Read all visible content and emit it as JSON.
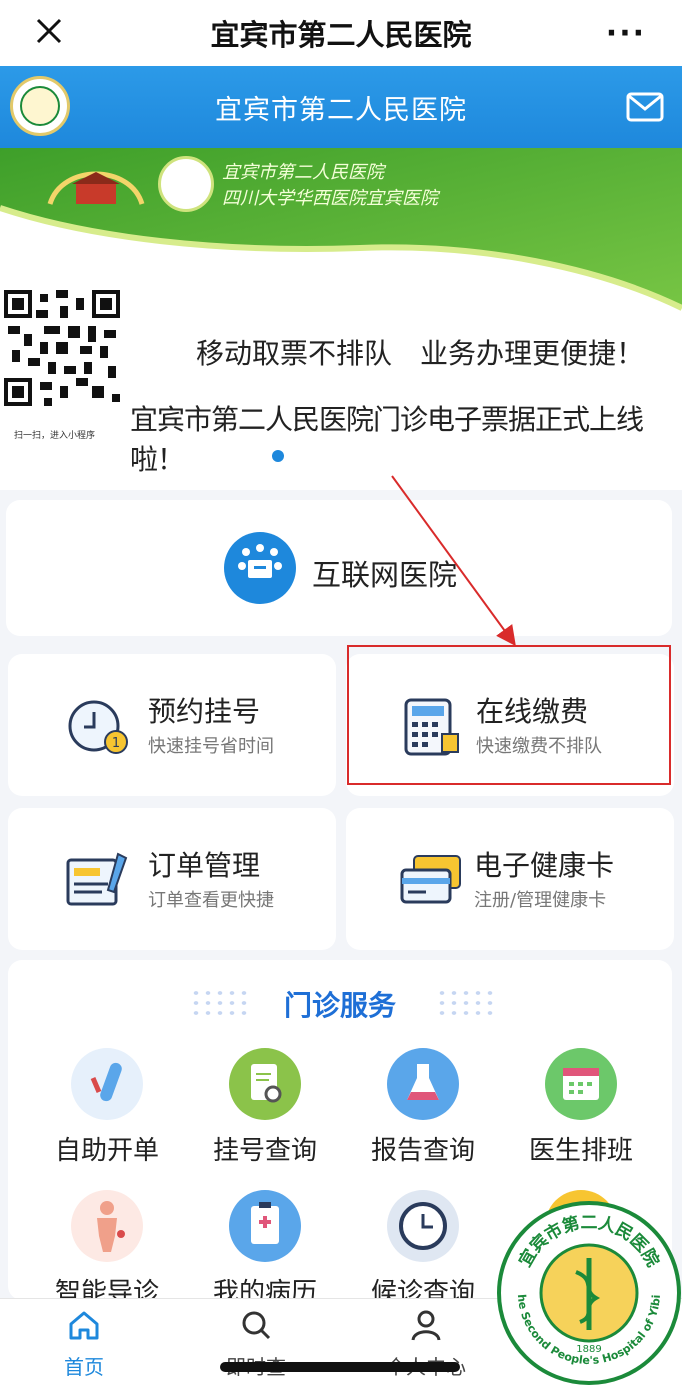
{
  "wechat_bar": {
    "title": "宜宾市第二人民医院",
    "more_label": "···"
  },
  "header": {
    "title": "宜宾市第二人民医院"
  },
  "banner": {
    "logo_text_line1": "宜宾市第二人民医院",
    "logo_text_line2": "四川大学华西医院宜宾医院",
    "qr_caption": "扫一扫，进入小程序",
    "line1": "移动取票不排队　业务办理更便捷！",
    "line2": "宜宾市第二人民医院门诊电子票据正式上线啦！"
  },
  "internet_hospital": {
    "label": "互联网医院"
  },
  "services": [
    {
      "title": "预约挂号",
      "subtitle": "快速挂号省时间"
    },
    {
      "title": "在线缴费",
      "subtitle": "快速缴费不排队"
    },
    {
      "title": "订单管理",
      "subtitle": "订单查看更快捷"
    },
    {
      "title": "电子健康卡",
      "subtitle": "注册/管理健康卡"
    }
  ],
  "outpatient": {
    "title": "门诊服务",
    "items": [
      {
        "label": "自助开单",
        "icon": "test-tube-icon"
      },
      {
        "label": "挂号查询",
        "icon": "document-search-icon"
      },
      {
        "label": "报告查询",
        "icon": "flask-icon"
      },
      {
        "label": "医生排班",
        "icon": "calendar-icon"
      },
      {
        "label": "智能导诊",
        "icon": "body-icon"
      },
      {
        "label": "我的病历",
        "icon": "clipboard-icon"
      },
      {
        "label": "候诊查询",
        "icon": "clock-icon"
      },
      {
        "label": "",
        "icon": "generic-icon"
      }
    ]
  },
  "tabbar": {
    "items": [
      {
        "label": "首页",
        "icon": "home-icon"
      },
      {
        "label": "即时查",
        "icon": "search-icon"
      },
      {
        "label": "个人中心",
        "icon": "user-icon"
      }
    ]
  },
  "stamp": {
    "text_cn": "宜宾市第二人民医院",
    "text_en": "The Second People's Hospital of Yibin",
    "year": "1889"
  },
  "colors": {
    "brand_blue": "#1e88dc",
    "banner_green": "#4fae2f",
    "highlight_red": "#d92b2b",
    "section_title": "#1e6fd6"
  }
}
